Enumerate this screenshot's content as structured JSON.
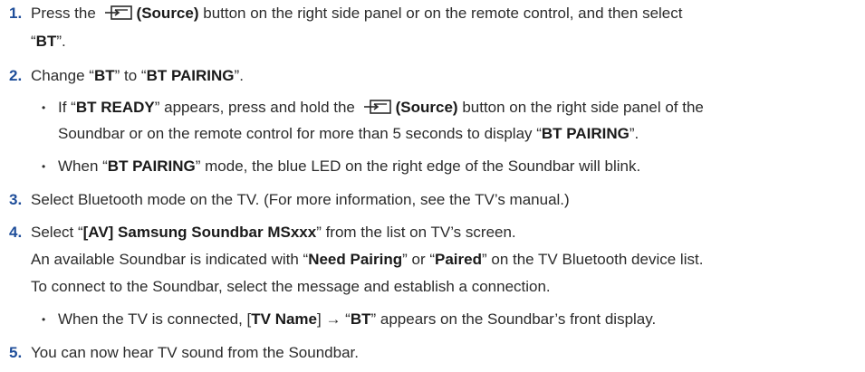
{
  "steps": [
    {
      "number": "1.",
      "pre": "Press the ",
      "source_label": "(Source)",
      "post": " button on the right side panel or on the remote control, and then select",
      "cont": [
        "“",
        "BT",
        "”."
      ]
    },
    {
      "number": "2.",
      "text": [
        "Change “",
        "BT",
        "” to “",
        "BT PAIRING",
        "”."
      ],
      "bullets": [
        {
          "line1": [
            "If “",
            "BT READY",
            "” appears, press and hold the "
          ],
          "source_label": "(Source)",
          "line1_post": " button on the right side panel of the",
          "line2": [
            "Soundbar or on the remote control for more than 5 seconds to display “",
            "BT PAIRING",
            "”."
          ]
        },
        {
          "line1": [
            "When “",
            "BT PAIRING",
            "” mode, the blue LED on the right edge of the Soundbar will blink."
          ]
        }
      ]
    },
    {
      "number": "3.",
      "text": "Select Bluetooth mode on the TV. (For more information, see the TV’s manual.)"
    },
    {
      "number": "4.",
      "text": [
        "Select “",
        "[AV] Samsung Soundbar MSxxx",
        "” from the list on TV’s screen."
      ],
      "cont1": [
        "An available Soundbar is indicated with “",
        "Need Pairing",
        "” or “",
        "Paired",
        "” on the TV Bluetooth device list."
      ],
      "cont2": "To connect to the Soundbar, select the message and establish a connection.",
      "bullet": [
        "When the TV is connected, [",
        "TV Name",
        "] → “",
        "BT",
        "” appears on the Soundbar’s front display."
      ]
    },
    {
      "number": "5.",
      "text": "You can now hear TV sound from the Soundbar."
    }
  ],
  "bullet_glyph": "•",
  "icons": {
    "source": "source-input-icon"
  },
  "colors": {
    "accent": "#1f4e9a",
    "text": "#2b2b2b"
  }
}
